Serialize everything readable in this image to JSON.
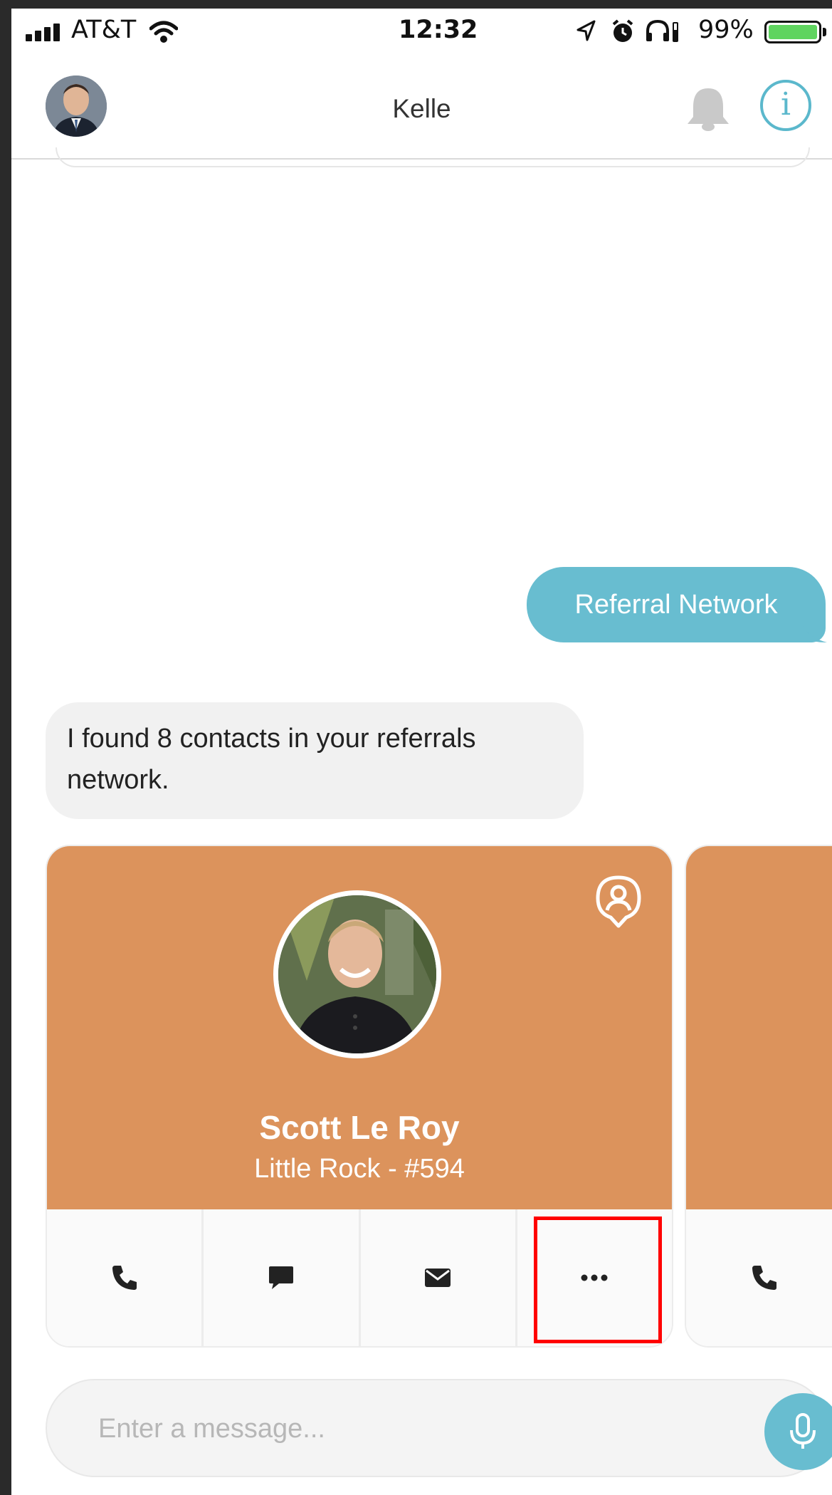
{
  "status_bar": {
    "carrier": "AT&T",
    "time": "12:32",
    "battery": "99%"
  },
  "header": {
    "title": "Kelle",
    "info_label": "i"
  },
  "messages": [
    {
      "from": "user",
      "text": "Referral Network"
    },
    {
      "from": "bot",
      "text": "I found 8 contacts in your referrals network."
    }
  ],
  "contacts": [
    {
      "name": "Scott Le Roy",
      "subtitle": "Little Rock - #594"
    }
  ],
  "composer": {
    "placeholder": "Enter a message..."
  },
  "icons": [
    "signal-icon",
    "wifi-icon",
    "location-arrow-icon",
    "alarm-icon",
    "headphones-icon",
    "battery-icon",
    "bell-icon",
    "info-icon",
    "contact-pin-icon",
    "phone-icon",
    "chat-icon",
    "mail-icon",
    "more-icon",
    "microphone-icon"
  ],
  "colors": {
    "accent": "#68bdd0",
    "card": "#dc935c",
    "highlight": "#ff0000"
  }
}
